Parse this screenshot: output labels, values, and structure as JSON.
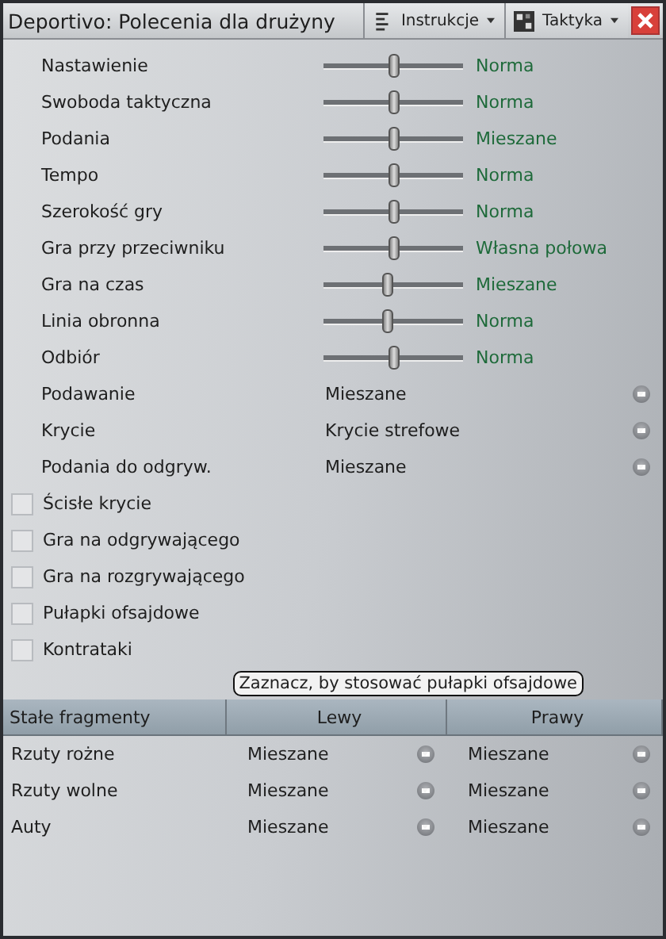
{
  "window": {
    "title": "Deportivo: Polecenia dla drużyny"
  },
  "menus": [
    {
      "label": "Instrukcje"
    },
    {
      "label": "Taktyka"
    }
  ],
  "sliders": [
    {
      "label": "Nastawienie",
      "level": 0.5,
      "value": "Norma"
    },
    {
      "label": "Swoboda taktyczna",
      "level": 0.5,
      "value": "Norma"
    },
    {
      "label": "Podania",
      "level": 0.5,
      "value": "Mieszane"
    },
    {
      "label": "Tempo",
      "level": 0.5,
      "value": "Norma"
    },
    {
      "label": "Szerokość gry",
      "level": 0.5,
      "value": "Norma"
    },
    {
      "label": "Gra przy przeciwniku",
      "level": 0.5,
      "value": "Własna połowa"
    },
    {
      "label": "Gra na czas",
      "level": 0.46,
      "value": "Mieszane"
    },
    {
      "label": "Linia obronna",
      "level": 0.46,
      "value": "Norma"
    },
    {
      "label": "Odbiór",
      "level": 0.5,
      "value": "Norma"
    }
  ],
  "dropdowns": [
    {
      "label": "Podawanie",
      "value": "Mieszane"
    },
    {
      "label": "Krycie",
      "value": "Krycie strefowe"
    },
    {
      "label": "Podania do odgryw.",
      "value": "Mieszane"
    }
  ],
  "checkboxes": [
    {
      "label": "Ścisłe krycie",
      "checked": false
    },
    {
      "label": "Gra na odgrywającego",
      "checked": false
    },
    {
      "label": "Gra na rozgrywającego",
      "checked": false
    },
    {
      "label": "Pułapki ofsajdowe",
      "checked": false
    },
    {
      "label": "Kontrataki",
      "checked": false
    }
  ],
  "tooltip": "Zaznacz, by stosować pułapki ofsajdowe",
  "set_pieces": {
    "columns": [
      "Stałe fragmenty",
      "Lewy",
      "Prawy"
    ],
    "rows": [
      {
        "name": "Rzuty rożne",
        "left": "Mieszane",
        "right": "Mieszane"
      },
      {
        "name": "Rzuty wolne",
        "left": "Mieszane",
        "right": "Mieszane"
      },
      {
        "name": "Auty",
        "left": "Mieszane",
        "right": "Mieszane"
      }
    ]
  }
}
